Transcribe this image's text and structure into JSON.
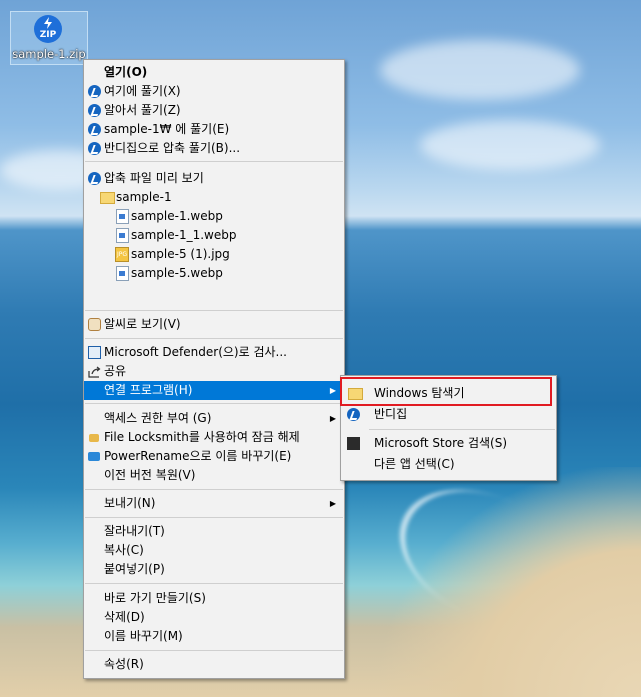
{
  "desktop": {
    "icon_label": "sample-1.zip",
    "icon_badge": "ZIP"
  },
  "context_menu": {
    "open": "열기(O)",
    "extract_here": "여기에 풀기(X)",
    "extract_smart": "알아서 풀기(Z)",
    "extract_to": "sample-1₩ 에 풀기(E)",
    "extract_bandizip": "반디집으로 압축 풀기(B)...",
    "preview": "압축 파일 미리 보기",
    "preview_folder": "sample-1",
    "preview_files": [
      "sample-1.webp",
      "sample-1_1.webp",
      "sample-5 (1).jpg",
      "sample-5.webp"
    ],
    "alzip_view": "알씨로 보기(V)",
    "defender": "Microsoft Defender(으)로 검사...",
    "share": "공유",
    "open_with": "연결 프로그램(H)",
    "grant_access": "액세스 권한 부여 (G)",
    "file_locksmith": "File Locksmith를 사용하여 잠금 해제",
    "power_rename": "PowerRename으로 이름 바꾸기(E)",
    "restore_versions": "이전 버전 복원(V)",
    "send_to": "보내기(N)",
    "cut": "잘라내기(T)",
    "copy": "복사(C)",
    "paste": "붙여넣기(P)",
    "create_shortcut": "바로 가기 만들기(S)",
    "delete": "삭제(D)",
    "rename": "이름 바꾸기(M)",
    "properties": "속성(R)"
  },
  "submenu": {
    "windows_explorer": "Windows 탐색기",
    "bandizip": "반디집",
    "store_search": "Microsoft Store 검색(S)",
    "choose_other": "다른 앱 선택(C)"
  }
}
